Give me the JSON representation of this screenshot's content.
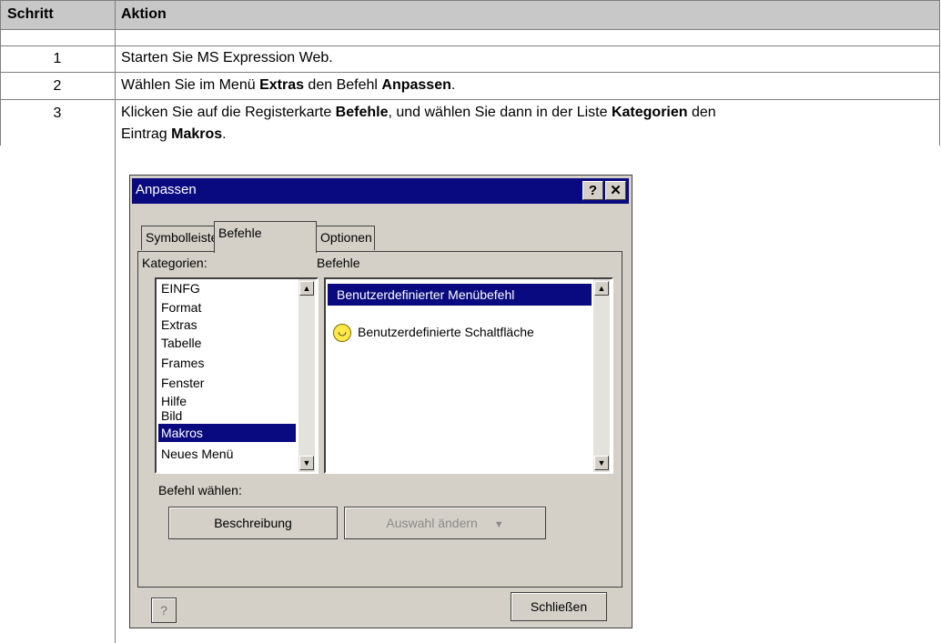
{
  "table": {
    "headers": {
      "step": "Schritt",
      "action": "Aktion"
    },
    "rows": [
      {
        "step": "1",
        "action": "Starten Sie MS Expression Web."
      },
      {
        "step": "2",
        "action_parts": [
          "Wählen Sie im Menü ",
          "Extras",
          " den Befehl ",
          "Anpassen",
          "."
        ]
      },
      {
        "step": "3",
        "action_parts": [
          "Klicken Sie auf die Registerkarte ",
          "Befehle",
          ", und wählen Sie dann in der Liste ",
          "Kategorien",
          " den",
          "Eintrag ",
          "Makros",
          "."
        ]
      }
    ]
  },
  "dialog": {
    "title": "Anpassen",
    "help_glyph": "?",
    "close_glyph": "✕",
    "tabs": [
      "Symbolleisten",
      "Befehle",
      "Optionen"
    ],
    "categories_label": "Kategorien:",
    "commands_label": "Befehle",
    "categories": [
      "EINFG",
      "Format",
      "Extras",
      "Tabelle",
      "Frames",
      "Fenster",
      "Hilfe",
      "Bild",
      "Makros",
      "Neues Menü"
    ],
    "selected_category": "Makros",
    "commands": [
      {
        "label": "Benutzerdefinierter Menübefehl",
        "icon": "",
        "selected": true
      },
      {
        "label": "Benutzerdefinierte Schaltfläche",
        "icon": "smiley-icon",
        "selected": false
      }
    ],
    "select_command_label": "Befehl wählen:",
    "describe_button": "Beschreibung",
    "modify_button": "Auswahl ändern",
    "help_button_glyph": "?",
    "close_button": "Schließen"
  }
}
